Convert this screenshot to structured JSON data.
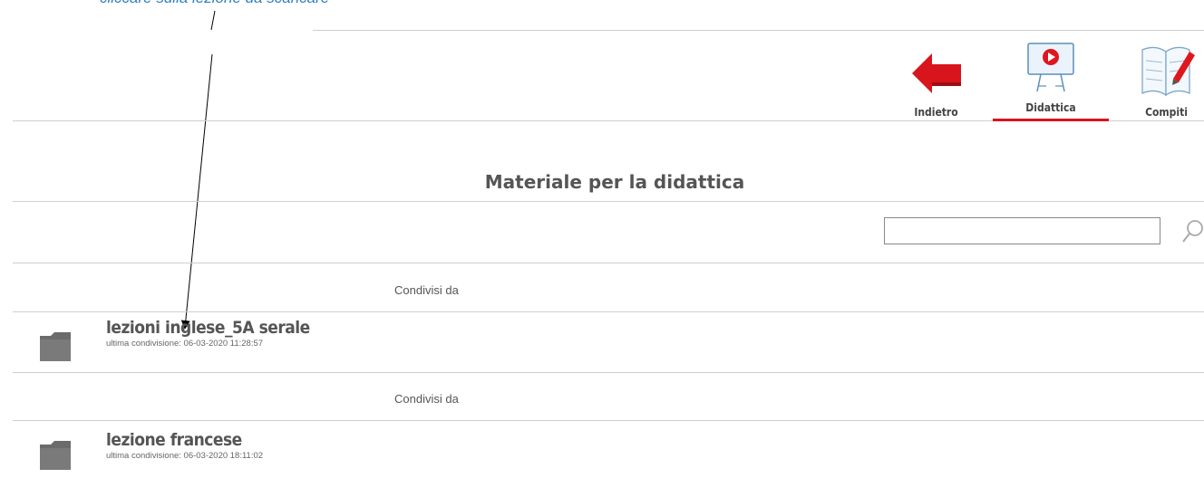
{
  "annotation": {
    "text": "cliccare sulla lezione da scaricare"
  },
  "toolbar": {
    "items": [
      {
        "label": "Indietro",
        "icon": "back-arrow-icon"
      },
      {
        "label": "Didattica",
        "icon": "whiteboard-play-icon",
        "active": true
      },
      {
        "label": "Compiti",
        "icon": "notebook-pen-icon"
      }
    ]
  },
  "page": {
    "title": "Materiale per la didattica"
  },
  "search": {
    "value": "",
    "placeholder": "",
    "icon": "search-icon"
  },
  "folders": [
    {
      "shared_by_label": "Condivisi da",
      "name": "lezioni inglese_5A serale",
      "meta": "ultima condivisione: 06-03-2020 11:28:57",
      "icon": "folder-icon"
    },
    {
      "shared_by_label": "Condivisi da",
      "name": "lezione francese",
      "meta": "ultima condivisione: 06-03-2020 18:11:02",
      "icon": "folder-icon"
    }
  ],
  "colors": {
    "accent": "#d8141c",
    "annotation": "#2f7fbf",
    "folder": "#6b6b6b"
  }
}
